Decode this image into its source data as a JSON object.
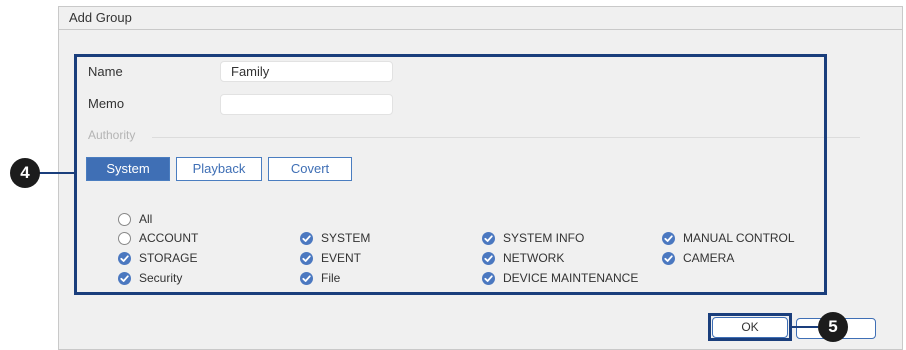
{
  "dialog": {
    "title": "Add Group"
  },
  "form": {
    "name_label": "Name",
    "name_value": "Family",
    "memo_label": "Memo",
    "memo_value": ""
  },
  "authority": {
    "label": "Authority",
    "tabs": [
      {
        "label": "System",
        "active": true
      },
      {
        "label": "Playback",
        "active": false
      },
      {
        "label": "Covert",
        "active": false
      }
    ],
    "permissions": [
      {
        "label": "All",
        "checked": false
      },
      {
        "label": "ACCOUNT",
        "checked": false
      },
      {
        "label": "SYSTEM",
        "checked": true
      },
      {
        "label": "SYSTEM INFO",
        "checked": true
      },
      {
        "label": "MANUAL CONTROL",
        "checked": true
      },
      {
        "label": "STORAGE",
        "checked": true
      },
      {
        "label": "EVENT",
        "checked": true
      },
      {
        "label": "NETWORK",
        "checked": true
      },
      {
        "label": "CAMERA",
        "checked": true
      },
      {
        "label": "Security",
        "checked": true
      },
      {
        "label": "File",
        "checked": true
      },
      {
        "label": "DEVICE MAINTENANCE",
        "checked": true
      }
    ]
  },
  "buttons": {
    "ok": "OK",
    "cancel": ""
  },
  "callouts": {
    "step4": "4",
    "step5": "5"
  },
  "colors": {
    "accent": "#3f6fb5",
    "highlight": "#1a3e7c",
    "check": "#4b78c0"
  }
}
